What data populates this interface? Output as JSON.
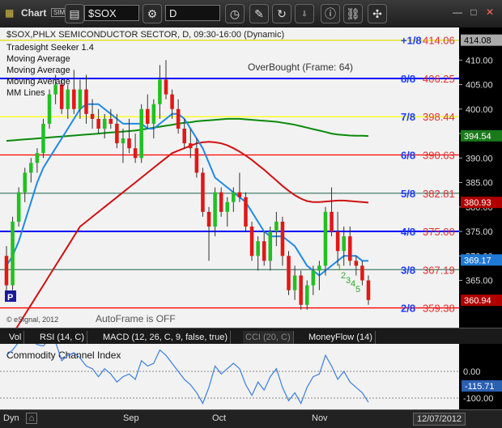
{
  "toolbar": {
    "title": "Chart",
    "badge": "SIM",
    "symbol": "$SOX",
    "interval": "D"
  },
  "price_panel": {
    "header": "$SOX,PHLX SEMICONDUCTOR SECTOR, D, 09:30-16:00 (Dynamic)",
    "studies": [
      "Tradesight Seeker 1.4",
      "Moving Average",
      "Moving Average",
      "Moving Average",
      "MM Lines"
    ],
    "overbought_label": "OverBought (Frame: 64)",
    "autoframe_label": "AutoFrame is OFF",
    "copyright": "© eSignal, 2012",
    "p_badge": "P",
    "mm_lines": [
      {
        "label": "+1/8",
        "value": "414.06",
        "price": 414.06,
        "color": "#e0e000",
        "labelColor": "#1e3cff"
      },
      {
        "label": "8/8",
        "value": "406.25",
        "price": 406.25,
        "color": "#0000ff",
        "labelColor": "#1e3cff"
      },
      {
        "label": "7/8",
        "value": "398.44",
        "price": 398.44,
        "color": "#ffff00",
        "labelColor": "#1e3cff"
      },
      {
        "label": "6/8",
        "value": "390.63",
        "price": 390.63,
        "color": "#ff0000",
        "labelColor": "#1e3cff"
      },
      {
        "label": "5/8",
        "value": "382.81",
        "price": 382.81,
        "color": "#558877",
        "labelColor": "#1e3cff"
      },
      {
        "label": "4/8",
        "value": "375.00",
        "price": 375.0,
        "color": "#0000ff",
        "labelColor": "#1e3cff"
      },
      {
        "label": "3/8",
        "value": "367.19",
        "price": 367.19,
        "color": "#558877",
        "labelColor": "#1e3cff"
      },
      {
        "label": "2/8",
        "value": "359.38",
        "price": 359.38,
        "color": "#ff0000",
        "labelColor": "#1e3cff"
      }
    ],
    "y_ticks": [
      410,
      405,
      400,
      395,
      390,
      385,
      380,
      375,
      370,
      365
    ],
    "tags": [
      {
        "value": "414.08",
        "price": 414.08,
        "bg": "#aaaaaa",
        "fg": "#000000"
      },
      {
        "value": "394.54",
        "price": 394.54,
        "bg": "#1a7a1a",
        "fg": "#ffffff"
      },
      {
        "value": "380.93",
        "price": 380.93,
        "bg": "#b00000",
        "fg": "#ffffff"
      },
      {
        "value": "369.17",
        "price": 369.17,
        "bg": "#1e7ad6",
        "fg": "#ffffff"
      },
      {
        "value": "360.94",
        "price": 360.94,
        "bg": "#b00000",
        "fg": "#ffffff"
      }
    ],
    "seeker_counts": [
      "1",
      "2",
      "3",
      "4",
      "5"
    ]
  },
  "indicator_tabs": [
    "Vol",
    "RSI (14, C)",
    "MACD (12, 26, C, 9, false, true)",
    "CCI (20, C)",
    "MoneyFlow (14)"
  ],
  "cci_panel": {
    "title": "Commodity Channel Index",
    "y_ticks": [
      "0.00",
      "-100.00"
    ],
    "current": "-115.71"
  },
  "x_axis": {
    "labels": [
      "Dyn",
      "Sep",
      "Oct",
      "Nov"
    ],
    "date": "12/07/2012"
  },
  "chart_data": {
    "type": "candlestick",
    "ylim": [
      356,
      416
    ],
    "candles": [
      [
        370,
        372,
        362,
        364
      ],
      [
        364,
        378,
        363,
        377
      ],
      [
        377,
        384,
        376,
        383
      ],
      [
        383,
        388,
        381,
        387
      ],
      [
        387,
        390,
        385,
        389
      ],
      [
        389,
        392,
        387,
        391
      ],
      [
        391,
        398,
        390,
        397
      ],
      [
        397,
        404,
        396,
        403
      ],
      [
        403,
        407,
        401,
        405
      ],
      [
        405,
        406,
        399,
        400
      ],
      [
        400,
        405,
        398,
        404
      ],
      [
        404,
        408,
        399,
        400
      ],
      [
        400,
        406,
        398,
        404
      ],
      [
        404,
        407,
        397,
        399
      ],
      [
        399,
        402,
        396,
        398
      ],
      [
        398,
        400,
        395,
        396
      ],
      [
        396,
        399,
        394,
        398
      ],
      [
        398,
        400,
        396,
        397
      ],
      [
        397,
        399,
        392,
        393
      ],
      [
        393,
        396,
        389,
        394
      ],
      [
        394,
        398,
        391,
        392
      ],
      [
        392,
        395,
        389,
        390
      ],
      [
        390,
        401,
        389,
        400
      ],
      [
        400,
        403,
        396,
        397
      ],
      [
        397,
        402,
        394,
        401
      ],
      [
        401,
        409,
        398,
        406
      ],
      [
        406,
        410,
        402,
        403
      ],
      [
        403,
        404,
        398,
        400
      ],
      [
        400,
        402,
        395,
        396
      ],
      [
        396,
        398,
        392,
        393
      ],
      [
        393,
        396,
        390,
        392
      ],
      [
        392,
        394,
        386,
        387
      ],
      [
        387,
        388,
        378,
        379
      ],
      [
        379,
        380,
        369,
        376
      ],
      [
        376,
        384,
        374,
        383
      ],
      [
        383,
        384,
        378,
        379
      ],
      [
        379,
        382,
        376,
        381
      ],
      [
        381,
        384,
        379,
        383
      ],
      [
        383,
        387,
        381,
        382
      ],
      [
        382,
        383,
        375,
        376
      ],
      [
        376,
        377,
        369,
        370
      ],
      [
        370,
        374,
        367,
        373
      ],
      [
        373,
        375,
        368,
        369
      ],
      [
        369,
        376,
        367,
        375
      ],
      [
        375,
        379,
        372,
        377
      ],
      [
        377,
        378,
        368,
        370
      ],
      [
        370,
        371,
        362,
        363
      ],
      [
        363,
        368,
        361,
        366
      ],
      [
        366,
        367,
        359,
        360
      ],
      [
        360,
        365,
        359,
        364
      ],
      [
        364,
        368,
        362,
        367
      ],
      [
        367,
        369,
        363,
        368
      ],
      [
        368,
        380,
        366,
        379
      ],
      [
        379,
        384,
        374,
        375
      ],
      [
        375,
        379,
        368,
        371
      ],
      [
        371,
        376,
        368,
        374
      ],
      [
        374,
        376,
        368,
        369
      ],
      [
        369,
        370,
        366,
        368
      ],
      [
        368,
        369,
        364,
        365
      ],
      [
        365,
        366,
        360,
        361
      ]
    ],
    "ma_blue": [
      368,
      370,
      373,
      377,
      381,
      385,
      388,
      390,
      392,
      394,
      396,
      398,
      400,
      401,
      401,
      401,
      400,
      399,
      398,
      397,
      397,
      397,
      397,
      396,
      396,
      397,
      398,
      399,
      399,
      398,
      396,
      394,
      392,
      389,
      386,
      385,
      384,
      383,
      382,
      381,
      379,
      377,
      375,
      374,
      374,
      374,
      373,
      372,
      370,
      368,
      367,
      366,
      367,
      368,
      369,
      370,
      370,
      370,
      369,
      369
    ],
    "ma_red": [
      352,
      354,
      356,
      358,
      360,
      362,
      364,
      366,
      368,
      370,
      372,
      374,
      376,
      377,
      378,
      379,
      380,
      381,
      382,
      383,
      384,
      385,
      386,
      387,
      388,
      389,
      390,
      391,
      391.5,
      392,
      392.5,
      393,
      393.2,
      393.3,
      393.2,
      393,
      392.6,
      392,
      391.3,
      390.5,
      389.6,
      388.6,
      387.6,
      386.5,
      385.4,
      384.3,
      383.3,
      382.4,
      381.7,
      381.2,
      381,
      381,
      381.1,
      381.2,
      381.3,
      381.3,
      381.2,
      381.1,
      381,
      380.9
    ],
    "ma_green": [
      393.5,
      393.6,
      393.7,
      393.8,
      393.9,
      394,
      394.1,
      394.2,
      394.3,
      394.4,
      394.5,
      394.6,
      394.7,
      394.8,
      394.9,
      395,
      395.1,
      395.2,
      395.3,
      395.4,
      395.5,
      395.6,
      395.8,
      396,
      396.2,
      396.4,
      396.6,
      396.8,
      397,
      397.2,
      397.3,
      397.5,
      397.6,
      397.7,
      397.8,
      397.9,
      398,
      398,
      398,
      397.9,
      397.8,
      397.7,
      397.6,
      397.5,
      397.4,
      397.2,
      397,
      396.8,
      396.5,
      396.2,
      395.9,
      395.6,
      395.3,
      395,
      394.8,
      394.7,
      394.6,
      394.55,
      394.54,
      394.5
    ],
    "cci": [
      60,
      80,
      110,
      130,
      120,
      100,
      95,
      120,
      110,
      40,
      60,
      70,
      50,
      20,
      10,
      -20,
      10,
      -10,
      -40,
      -20,
      -10,
      -30,
      40,
      20,
      30,
      80,
      60,
      30,
      0,
      -30,
      -50,
      -80,
      -120,
      -60,
      20,
      -10,
      10,
      30,
      10,
      -50,
      -90,
      -40,
      -70,
      -20,
      10,
      -60,
      -110,
      -80,
      -120,
      -60,
      -20,
      -10,
      60,
      20,
      -30,
      0,
      -40,
      -60,
      -80,
      -115.71
    ]
  }
}
